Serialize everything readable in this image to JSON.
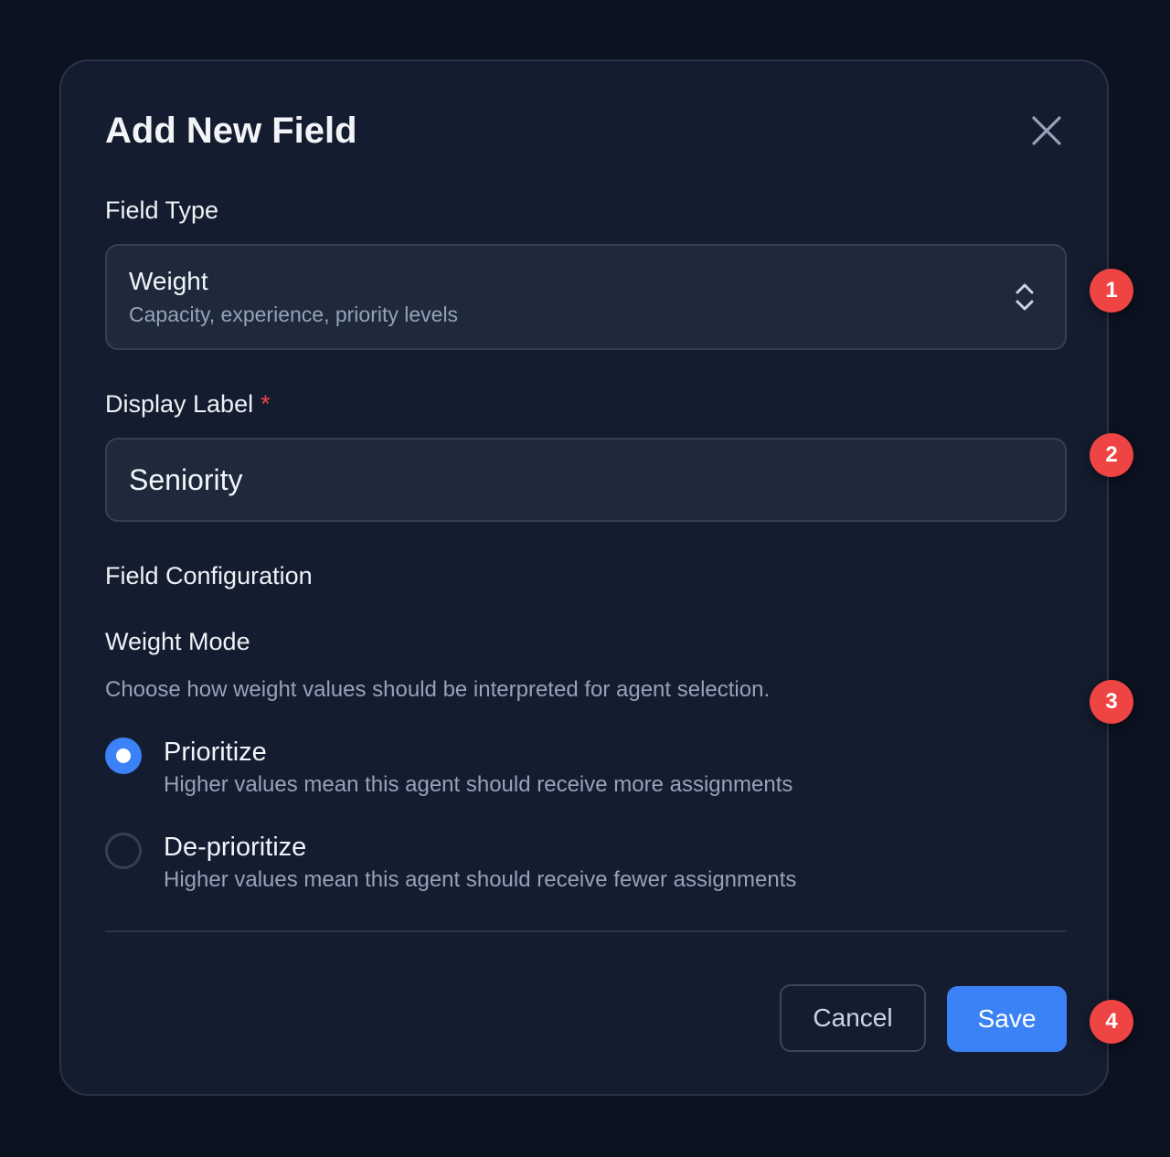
{
  "dialog": {
    "title": "Add New Field",
    "close_icon": "close-icon"
  },
  "field_type": {
    "label": "Field Type",
    "selected_value": "Weight",
    "selected_description": "Capacity, experience, priority levels",
    "icon": "chevron-up-down-icon"
  },
  "display_label": {
    "label": "Display Label",
    "required_marker": "*",
    "value": "Seniority"
  },
  "configuration": {
    "heading": "Field Configuration",
    "weight_mode": {
      "label": "Weight Mode",
      "help": "Choose how weight values should be interpreted for agent selection.",
      "options": [
        {
          "title": "Prioritize",
          "description": "Higher values mean this agent should receive more assignments",
          "selected": true
        },
        {
          "title": "De-prioritize",
          "description": "Higher values mean this agent should receive fewer assignments",
          "selected": false
        }
      ]
    }
  },
  "footer": {
    "cancel_label": "Cancel",
    "save_label": "Save"
  },
  "annotations": [
    "1",
    "2",
    "3",
    "4"
  ],
  "colors": {
    "background": "#0c1220",
    "dialog": "#141c2f",
    "input": "#1e293b",
    "accent": "#3b82f6",
    "required": "#ef4444",
    "badge": "#ef4444"
  }
}
